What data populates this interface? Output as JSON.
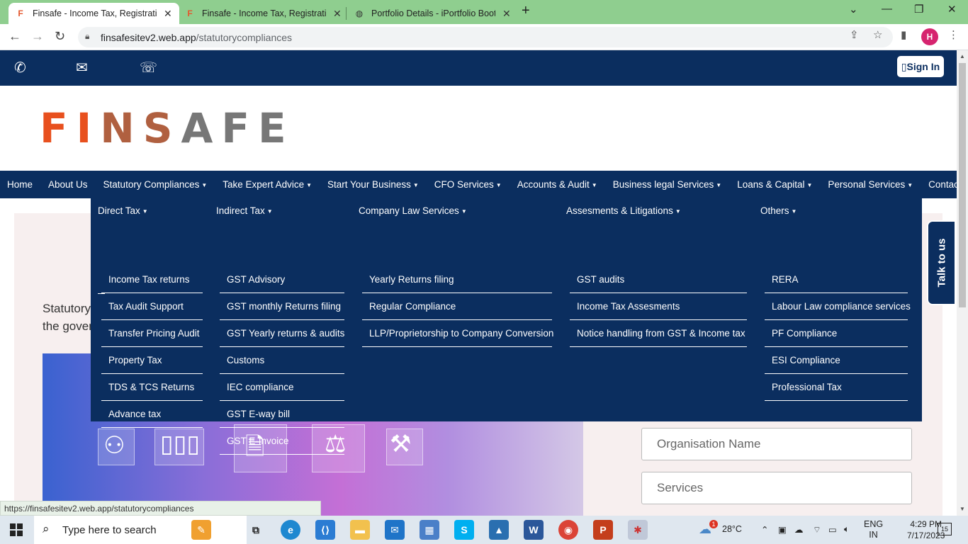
{
  "browser": {
    "tabs": [
      {
        "title": "Finsafe - Income Tax, Registration",
        "active": true
      },
      {
        "title": "Finsafe - Income Tax, Registration",
        "active": false
      },
      {
        "title": "Portfolio Details - iPortfolio Boot",
        "active": false
      }
    ],
    "url_domain": "finsafesitev2.web.app",
    "url_path": "/statutorycompliances"
  },
  "topbar": {
    "signin_label": "Sign In"
  },
  "logo": {
    "part1": "FI",
    "part2": "NS",
    "part3": "AFE"
  },
  "nav": {
    "items": [
      {
        "label": "Home",
        "dropdown": false
      },
      {
        "label": "About Us",
        "dropdown": false
      },
      {
        "label": "Statutory Compliances",
        "dropdown": true
      },
      {
        "label": "Take Expert Advice",
        "dropdown": true
      },
      {
        "label": "Start Your Business",
        "dropdown": true
      },
      {
        "label": "CFO Services",
        "dropdown": true
      },
      {
        "label": "Accounts & Audit",
        "dropdown": true
      },
      {
        "label": "Business legal Services",
        "dropdown": true
      },
      {
        "label": "Loans & Capital",
        "dropdown": true
      },
      {
        "label": "Personal Services",
        "dropdown": true
      },
      {
        "label": "Contact Us",
        "dropdown": false
      }
    ]
  },
  "megamenu": {
    "columns": [
      {
        "heading": "Direct Tax",
        "links": [
          "Income Tax returns",
          "Tax Audit Support",
          "Transfer Pricing Audit",
          "Property Tax",
          "TDS & TCS Returns",
          "Advance tax"
        ]
      },
      {
        "heading": "Indirect Tax",
        "links": [
          "GST Advisory",
          "GST monthly Returns filing",
          "GST Yearly returns & audits",
          "Customs",
          "IEC compliance",
          "GST E-way bill",
          "GST E-Invoice"
        ]
      },
      {
        "heading": "Company Law Services",
        "links": [
          "Yearly Returns filing",
          "Regular Compliance",
          "LLP/Proprietorship to Company Conversion"
        ]
      },
      {
        "heading": "Assesments & Litigations",
        "links": [
          "GST audits",
          "Income Tax Assesments",
          "Notice handling from GST & Income tax"
        ]
      },
      {
        "heading": "Others",
        "links": [
          "RERA",
          "Labour Law compliance services",
          "PF Compliance",
          "ESI Compliance",
          "Professional Tax"
        ]
      }
    ]
  },
  "content": {
    "intro_line1": "Statutory",
    "intro_line2": "the gover"
  },
  "form": {
    "org_placeholder": "Organisation Name",
    "services_placeholder": "Services"
  },
  "talk": {
    "label": "Talk to us"
  },
  "status_url": "https://finsafesitev2.web.app/statutorycompliances",
  "taskbar": {
    "search_placeholder": "Type here to search",
    "weather": "28°C",
    "weather_badge": "1",
    "lang_line1": "ENG",
    "lang_line2": "IN",
    "time": "4:29 PM",
    "date": "7/17/2023",
    "notification_count": "15"
  },
  "colors": {
    "brand_navy": "#0b2e5f",
    "logo_orange": "#e8501e",
    "logo_gray": "#777777",
    "tabbar_green": "#8fce8f"
  }
}
